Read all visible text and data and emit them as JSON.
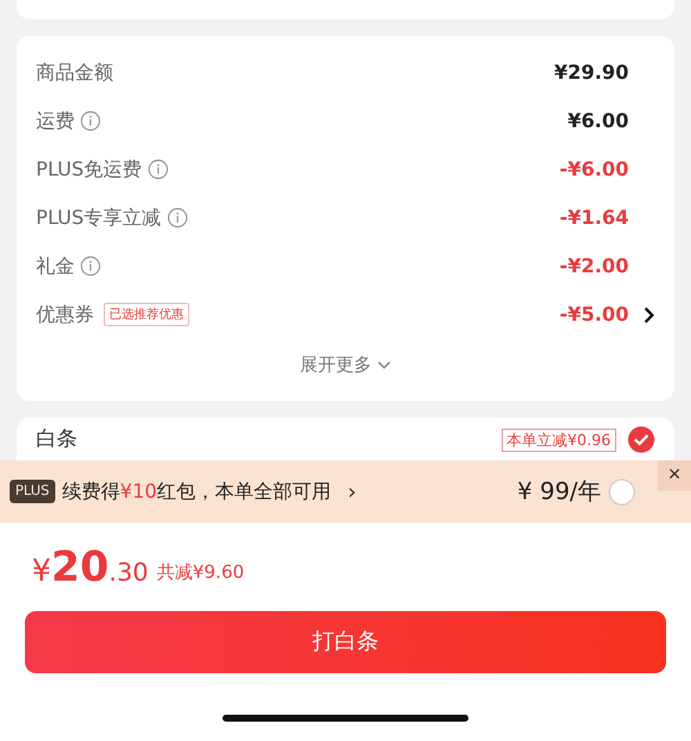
{
  "summary": {
    "rows": [
      {
        "label": "商品金额",
        "info": false,
        "value": "¥29.90",
        "negative": false,
        "arrow": false
      },
      {
        "label": "运费",
        "info": true,
        "value": "¥6.00",
        "negative": false,
        "arrow": false
      },
      {
        "label": "PLUS免运费",
        "info": true,
        "value": "-¥6.00",
        "negative": true,
        "arrow": false
      },
      {
        "label": "PLUS专享立减",
        "info": true,
        "value": "-¥1.64",
        "negative": true,
        "arrow": false
      },
      {
        "label": "礼金",
        "info": true,
        "value": "-¥2.00",
        "negative": true,
        "arrow": false
      },
      {
        "label": "优惠券",
        "info": false,
        "tag": "已选推荐优惠",
        "value": "-¥5.00",
        "negative": true,
        "arrow": true
      }
    ],
    "expand": "展开更多"
  },
  "payment": {
    "label": "白条",
    "tag": "本单立减¥0.96",
    "checked": true
  },
  "plus_banner": {
    "badge": "PLUS",
    "text": "续费得**¥10**红包，本单全部可用",
    "arrow": "›",
    "price": "¥ 99/年",
    "checked": false,
    "close": "×"
  },
  "footer": {
    "price_symbol": "¥",
    "price_int": "20",
    "price_dec": ".30",
    "saving": "共减¥9.60",
    "button": "打白条"
  }
}
